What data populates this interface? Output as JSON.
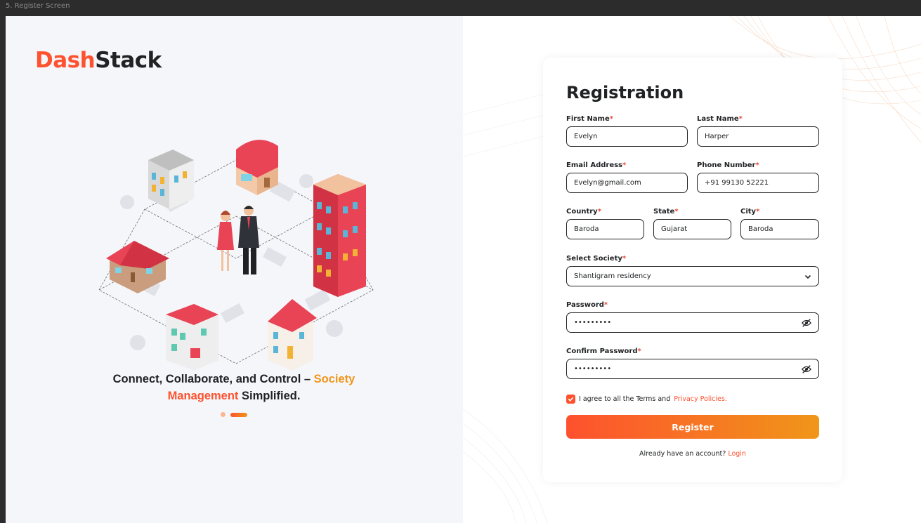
{
  "frame_label": "5. Register Screen",
  "brand": {
    "part1": "Dash",
    "part2": "Stack"
  },
  "tagline": {
    "prefix": "Connect, Collaborate, and Control – ",
    "highlight1": "Society",
    "highlight2": "Management",
    "suffix": " Simplified."
  },
  "form": {
    "title": "Registration",
    "first_name": {
      "label": "First Name",
      "value": "Evelyn"
    },
    "last_name": {
      "label": "Last Name",
      "value": "Harper"
    },
    "email": {
      "label": "Email Address",
      "value": "Evelyn@gmail.com"
    },
    "phone": {
      "label": "Phone Number",
      "value": "+91 99130 52221"
    },
    "country": {
      "label": "Country",
      "value": "Baroda"
    },
    "state": {
      "label": "State",
      "value": "Gujarat"
    },
    "city": {
      "label": "City",
      "value": "Baroda"
    },
    "society": {
      "label": "Select Society",
      "value": "Shantigram residency"
    },
    "password": {
      "label": "Password",
      "value": "•••••••••"
    },
    "confirm_password": {
      "label": "Confirm Password",
      "value": "•••••••••"
    },
    "required_mark": "*",
    "terms_text": "I agree to all the Terms and ",
    "terms_link": "Privacy Policies.",
    "register_label": "Register",
    "login_prompt": "Already have an account? ",
    "login_link": "Login"
  },
  "colors": {
    "accent": "#fe512e",
    "accent2": "#f09619",
    "text": "#202224"
  },
  "icons": [
    "eye-off-icon",
    "chevron-down-icon",
    "check-icon"
  ]
}
